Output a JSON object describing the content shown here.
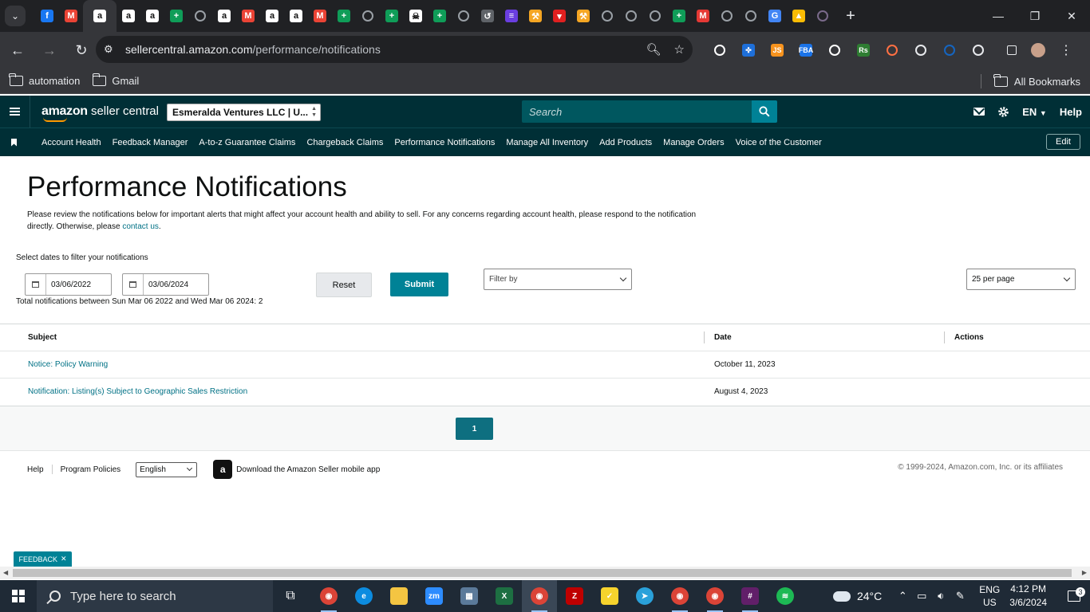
{
  "browser": {
    "tabs": [
      {
        "icon": "facebook-icon",
        "glyph": "f",
        "color": "#1877f2"
      },
      {
        "icon": "gmail-icon",
        "glyph": "M",
        "color": "#ea4335"
      },
      {
        "icon": "amazon-icon",
        "glyph": "a",
        "color": "#111111",
        "active": true
      },
      {
        "icon": "amazon-icon",
        "glyph": "a",
        "color": "#111111"
      },
      {
        "icon": "amazon-icon",
        "glyph": "a",
        "color": "#111111"
      },
      {
        "icon": "sheets-icon",
        "glyph": "+",
        "color": "#0f9d58"
      },
      {
        "icon": "globe-icon",
        "glyph": "",
        "color": "#9aa0a6"
      },
      {
        "icon": "amazon-icon",
        "glyph": "a",
        "color": "#111111"
      },
      {
        "icon": "gmail-icon",
        "glyph": "M",
        "color": "#ea4335"
      },
      {
        "icon": "amazon-icon",
        "glyph": "a",
        "color": "#111111"
      },
      {
        "icon": "amazon-icon",
        "glyph": "a",
        "color": "#111111"
      },
      {
        "icon": "gmail-icon",
        "glyph": "M",
        "color": "#ea4335"
      },
      {
        "icon": "sheets-icon",
        "glyph": "+",
        "color": "#0f9d58"
      },
      {
        "icon": "globe-icon",
        "glyph": "",
        "color": "#9aa0a6"
      },
      {
        "icon": "sheets-icon",
        "glyph": "+",
        "color": "#0f9d58"
      },
      {
        "icon": "skull-icon",
        "glyph": "☠",
        "color": "#111111"
      },
      {
        "icon": "sheets-icon",
        "glyph": "+",
        "color": "#0f9d58"
      },
      {
        "icon": "globe-icon",
        "glyph": "",
        "color": "#9aa0a6"
      },
      {
        "icon": "history-icon",
        "glyph": "↺",
        "color": "#5f6368"
      },
      {
        "icon": "list-icon",
        "glyph": "≡",
        "color": "#6a3ee0"
      },
      {
        "icon": "tool-icon",
        "glyph": "⚒",
        "color": "#f5a623"
      },
      {
        "icon": "red-tab-icon",
        "glyph": "▾",
        "color": "#e02020"
      },
      {
        "icon": "tool-icon",
        "glyph": "⚒",
        "color": "#f5a623"
      },
      {
        "icon": "globe-icon",
        "glyph": "",
        "color": "#9aa0a6"
      },
      {
        "icon": "globe-icon",
        "glyph": "",
        "color": "#9aa0a6"
      },
      {
        "icon": "chrome-icon",
        "glyph": "",
        "color": "#9aa0a6"
      },
      {
        "icon": "sheets-icon",
        "glyph": "+",
        "color": "#0f9d58"
      },
      {
        "icon": "m-red-icon",
        "glyph": "M",
        "color": "#e53935"
      },
      {
        "icon": "globe-icon",
        "glyph": "",
        "color": "#9aa0a6"
      },
      {
        "icon": "globe-icon",
        "glyph": "",
        "color": "#9aa0a6"
      },
      {
        "icon": "google-icon",
        "glyph": "G",
        "color": "#4285f4"
      },
      {
        "icon": "drive-icon",
        "glyph": "▲",
        "color": "#fbbc04"
      },
      {
        "icon": "image-tab-icon",
        "glyph": "",
        "color": "#7a6a8a"
      }
    ],
    "url_host": "sellercentral.amazon.com",
    "url_path": "/performance/notifications",
    "extensions": [
      {
        "icon": "ext-logo-icon",
        "glyph": "",
        "color": "#ffffff"
      },
      {
        "icon": "ext-puzzle-blue-icon",
        "glyph": "✜",
        "color": "#1e6fd9"
      },
      {
        "icon": "ext-js-icon",
        "glyph": "JS",
        "color": "#f7931e"
      },
      {
        "icon": "ext-fba-icon",
        "glyph": "FBA",
        "color": "#1a73e8"
      },
      {
        "icon": "ext-helium-icon",
        "glyph": "",
        "color": "#ffffff"
      },
      {
        "icon": "ext-rs-icon",
        "glyph": "Rs",
        "color": "#2e7d32"
      },
      {
        "icon": "ext-orange-circle-icon",
        "glyph": "",
        "color": "#ff7043"
      },
      {
        "icon": "ext-globe-icon",
        "glyph": "",
        "color": "#e8eaed"
      },
      {
        "icon": "ext-chart-icon",
        "glyph": "",
        "color": "#1565c0"
      },
      {
        "icon": "extensions-icon",
        "glyph": "",
        "color": "#e8eaed"
      }
    ],
    "bookmarks": [
      "automation",
      "Gmail"
    ],
    "all_bookmarks": "All Bookmarks"
  },
  "header": {
    "logo_bold": "amazon",
    "logo_text": " seller central",
    "account": "Esmeralda Ventures LLC | U...",
    "search_placeholder": "Search",
    "language": "EN",
    "help": "Help"
  },
  "nav": {
    "links": [
      "Account Health",
      "Feedback Manager",
      "A-to-z Guarantee Claims",
      "Chargeback Claims",
      "Performance Notifications",
      "Manage All Inventory",
      "Add Products",
      "Manage Orders",
      "Voice of the Customer"
    ],
    "edit": "Edit"
  },
  "page": {
    "title": "Performance Notifications",
    "intro": "Please review the notifications below for important alerts that might affect your account health and ability to sell. For any concerns regarding account health, please respond to the notification directly. Otherwise, please ",
    "contact_link": "contact us",
    "intro_end": ".",
    "filter_label": "Select dates to filter your notifications",
    "date_from": "03/06/2022",
    "date_to": "03/06/2024",
    "reset": "Reset",
    "submit": "Submit",
    "filter_by": "Filter by",
    "per_page": "25 per page",
    "total": "Total notifications between Sun Mar 06 2022 and Wed Mar 06 2024: 2"
  },
  "table": {
    "headers": {
      "subject": "Subject",
      "date": "Date",
      "actions": "Actions"
    },
    "rows": [
      {
        "subject": "Notice: Policy Warning",
        "date": "October 11, 2023"
      },
      {
        "subject": "Notification: Listing(s) Subject to Geographic Sales Restriction",
        "date": "August 4, 2023"
      }
    ]
  },
  "pagination": {
    "current": "1"
  },
  "footer": {
    "help": "Help",
    "policies": "Program Policies",
    "language": "English",
    "app_text": "Download the Amazon Seller mobile app",
    "copyright": "© 1999-2024, Amazon.com, Inc. or its affiliates"
  },
  "feedback": "FEEDBACK",
  "taskbar": {
    "search_placeholder": "Type here to search",
    "apps": [
      {
        "icon": "chrome-icon",
        "glyph": "◉",
        "color": "#db4437",
        "state": "open"
      },
      {
        "icon": "edge-icon",
        "glyph": "e",
        "color": "#0c8ce0",
        "state": ""
      },
      {
        "icon": "file-explorer-icon",
        "glyph": "",
        "color": "#f4c542",
        "state": ""
      },
      {
        "icon": "zoom-icon",
        "glyph": "zm",
        "color": "#2d8cff",
        "state": ""
      },
      {
        "icon": "calculator-icon",
        "glyph": "▦",
        "color": "#5b7a9a",
        "state": ""
      },
      {
        "icon": "excel-icon",
        "glyph": "X",
        "color": "#1d6f42",
        "state": ""
      },
      {
        "icon": "chrome-profile-icon",
        "glyph": "◉",
        "color": "#db4437",
        "state": "active"
      },
      {
        "icon": "filezilla-icon",
        "glyph": "Z",
        "color": "#bf0000",
        "state": ""
      },
      {
        "icon": "sticky-notes-icon",
        "glyph": "✓",
        "color": "#f6d32d",
        "state": ""
      },
      {
        "icon": "telegram-icon",
        "glyph": "➤",
        "color": "#2aa1da",
        "state": ""
      },
      {
        "icon": "chrome-profile-icon",
        "glyph": "◉",
        "color": "#db4437",
        "state": "open"
      },
      {
        "icon": "chrome-profile-icon",
        "glyph": "◉",
        "color": "#db4437",
        "state": "open"
      },
      {
        "icon": "slack-icon",
        "glyph": "#",
        "color": "#611f69",
        "state": "open"
      },
      {
        "icon": "spotify-icon",
        "glyph": "≋",
        "color": "#1db954",
        "state": ""
      }
    ],
    "temperature": "24°C",
    "lang_top": "ENG",
    "lang_bottom": "US",
    "time": "4:12 PM",
    "date": "3/6/2024",
    "notifications": "3"
  }
}
